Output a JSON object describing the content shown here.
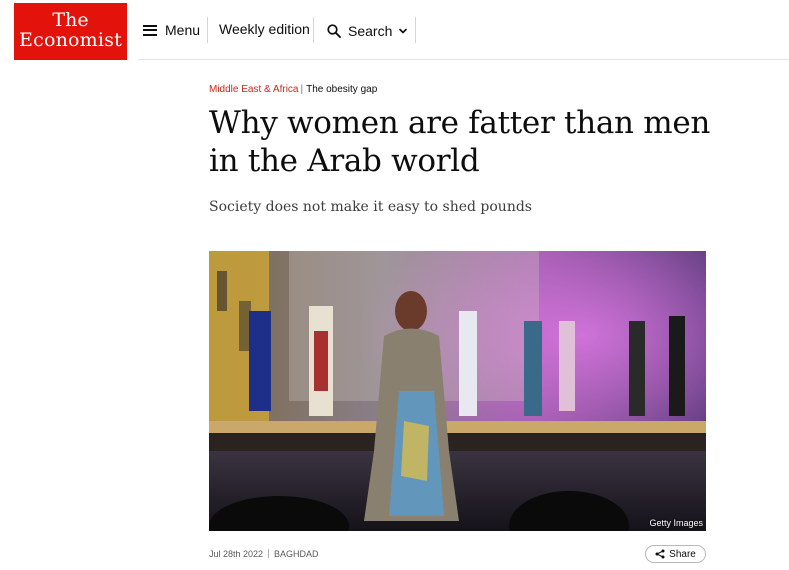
{
  "brand": {
    "line1": "The",
    "line2": "Economist",
    "color": "#e3120b"
  },
  "nav": {
    "menu_label": "Menu",
    "weekly_label": "Weekly edition",
    "search_label": "Search"
  },
  "article": {
    "section": "Middle East & Africa",
    "separator": "|",
    "fly_title": "The obesity gap",
    "headline": "Why women are fatter than men in the Arab world",
    "standfirst": "Society does not make it easy to shed pounds",
    "image_credit": "Getty Images",
    "date": "Jul 28th 2022",
    "dateline": "BAGHDAD",
    "share_label": "Share"
  },
  "colors": {
    "section_red": "#c9281a",
    "text": "#0d0d0d"
  },
  "icons": {
    "menu": "hamburger-icon",
    "search": "search-icon",
    "dropdown": "chevron-down-icon",
    "share": "share-icon"
  }
}
